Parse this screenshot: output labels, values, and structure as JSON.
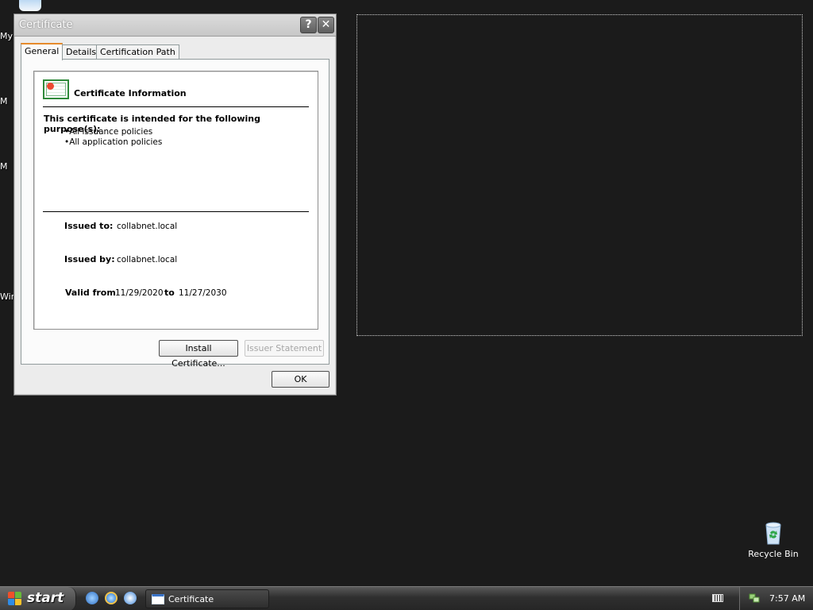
{
  "desktop": {
    "partial_labels": [
      "My",
      "M",
      "M",
      "Wir"
    ],
    "recycle_bin": {
      "label": "Recycle Bin"
    }
  },
  "dialog": {
    "title": "Certificate",
    "help_glyph": "?",
    "close_glyph": "✕",
    "tabs": [
      {
        "label": "General",
        "active": true
      },
      {
        "label": "Details",
        "active": false
      },
      {
        "label": "Certification Path",
        "active": false
      }
    ],
    "info": {
      "title": "Certificate Information",
      "purpose_heading": "This certificate is intended for the following purpose(s):",
      "purposes": [
        "All issuance policies",
        "All application policies"
      ],
      "issued_to_label": "Issued to:",
      "issued_to_value": "collabnet.local",
      "issued_by_label": "Issued by:",
      "issued_by_value": "collabnet.local",
      "valid_from_label": "Valid from",
      "valid_from_value": "11/29/2020",
      "valid_to_label": "to",
      "valid_to_value": "11/27/2030"
    },
    "buttons": {
      "install": "Install Certificate...",
      "issuer_statement": "Issuer Statement",
      "ok": "OK"
    }
  },
  "taskbar": {
    "start_label": "start",
    "task_button_label": "Certificate",
    "clock": "7:57 AM"
  },
  "colors": {
    "desktop_bg": "#1b1b1b",
    "active_tab_accent": "#e68b2c",
    "cert_icon_green": "#2f8a3a"
  }
}
